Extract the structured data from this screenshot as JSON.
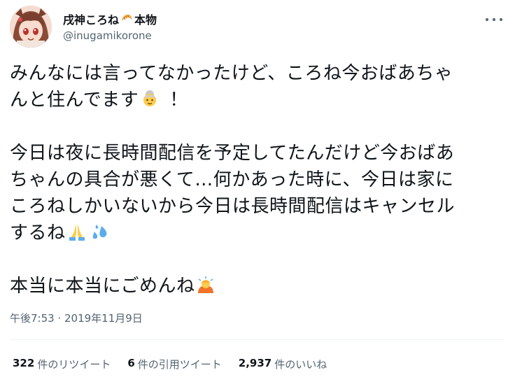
{
  "user": {
    "display_name": "戌神ころね",
    "display_name_suffix": "本物",
    "handle": "@inugamikorone"
  },
  "tweet": {
    "lines": [
      "みんなには言ってなかったけど、ころね今おばあちゃ",
      "んと住んでます",
      "今日は夜に長時間配信を予定してたんだけど今おばあ",
      "ちゃんの具合が悪くて…何かあった時に、今日は家に",
      "ころねしかいないから今日は長時間配信はキャンセル",
      "するね",
      "本当に本当にごめんね"
    ],
    "exclaim": "！"
  },
  "meta": {
    "timestamp": "午後7:53 · 2019年11月9日"
  },
  "stats": {
    "retweets_num": "322",
    "retweets_label": "件のリツイート",
    "quotes_num": "6",
    "quotes_label": "件の引用ツイート",
    "likes_num": "2,937",
    "likes_label": "件のいいね"
  },
  "icons": {
    "croissant": "croissant-emoji",
    "old_woman": "old-woman-emoji",
    "pray": "folded-hands-emoji",
    "sweat": "sweat-droplets-emoji",
    "bow": "person-bowing-emoji",
    "more": "more-icon"
  }
}
